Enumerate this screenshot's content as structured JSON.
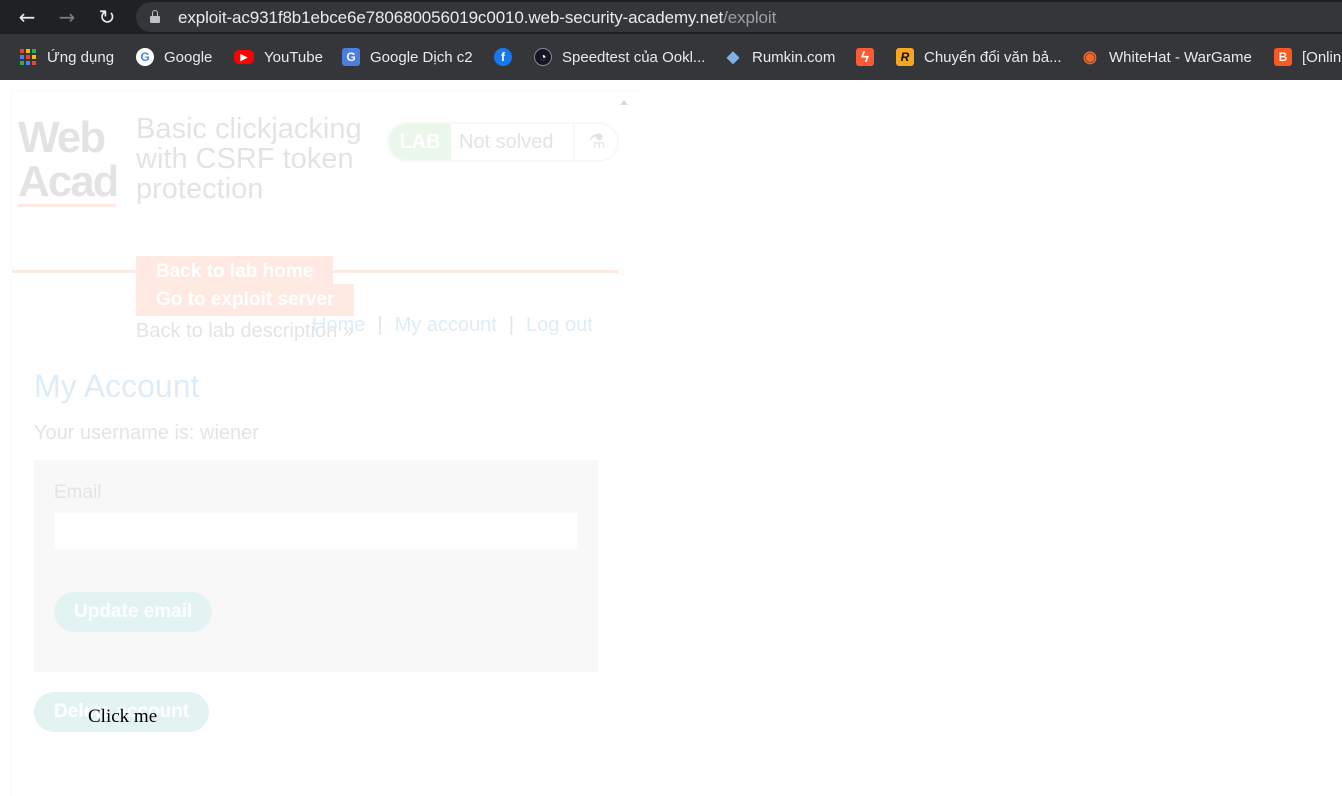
{
  "browser": {
    "url_host": "exploit-ac931f8b1ebce6e780680056019c0010.web-security-academy.net",
    "url_path": "/exploit",
    "back_glyph": "←",
    "forward_glyph": "→",
    "reload_glyph": "↻"
  },
  "bookmarks": [
    {
      "label": "Ứng dụng",
      "icon": "apps-grid-icon"
    },
    {
      "label": "Google",
      "icon": "google-icon",
      "glyph": "G",
      "color": "#ffffff",
      "fg": "#4285f4"
    },
    {
      "label": "YouTube",
      "icon": "youtube-icon",
      "glyph": "▶",
      "color": "#ff0000",
      "fg": "#ffffff"
    },
    {
      "label": "Google Dịch c2",
      "icon": "google-translate-icon",
      "glyph": "G",
      "color": "#4a7fe0",
      "fg": "#ffffff"
    },
    {
      "label": "",
      "icon": "facebook-icon",
      "glyph": "f",
      "color": "#1877f2",
      "fg": "#ffffff"
    },
    {
      "label": "Speedtest của Ookl...",
      "icon": "speedtest-icon",
      "glyph": "◔",
      "color": "#141526",
      "fg": "#ffffff"
    },
    {
      "label": "Rumkin.com",
      "icon": "rumkin-icon",
      "glyph": "◆",
      "color": "#35363a",
      "fg": "#7fb2e5"
    },
    {
      "label": "",
      "icon": "lightning-icon",
      "glyph": "ϟ",
      "color": "#ff5a36",
      "fg": "#ffffff"
    },
    {
      "label": "Chuyển đổi văn bả...",
      "icon": "r-icon",
      "glyph": "R",
      "color": "#f5a623",
      "fg": "#111111"
    },
    {
      "label": "WhiteHat - WarGame",
      "icon": "whitehat-icon",
      "glyph": "◉",
      "color": "#35363a",
      "fg": "#f06a2c"
    },
    {
      "label": "[Onlin",
      "icon": "blogger-icon",
      "glyph": "B",
      "color": "#ff5722",
      "fg": "#ffffff"
    }
  ],
  "lab": {
    "logo_text": "Web Acad",
    "title": "Basic clickjacking with CSRF token protection",
    "badge": "LAB",
    "status": "Not solved",
    "flask_glyph": "⚗",
    "back_home": "Back to lab home",
    "exploit_server": "Go to exploit server",
    "description_link": "Back to lab description »"
  },
  "nav": {
    "home": "Home",
    "my_account": "My account",
    "log_out": "Log out",
    "separator": "|"
  },
  "account": {
    "heading": "My Account",
    "username_text": "Your username is: wiener",
    "email_label": "Email",
    "email_value": "",
    "update_button": "Update email",
    "delete_button": "Delete account"
  },
  "decoy": {
    "text": "Click me"
  },
  "colors": {
    "orange": "#ff6633",
    "teal": "#30a89a",
    "blue": "#0071bc",
    "chrome_dark": "#202124"
  }
}
